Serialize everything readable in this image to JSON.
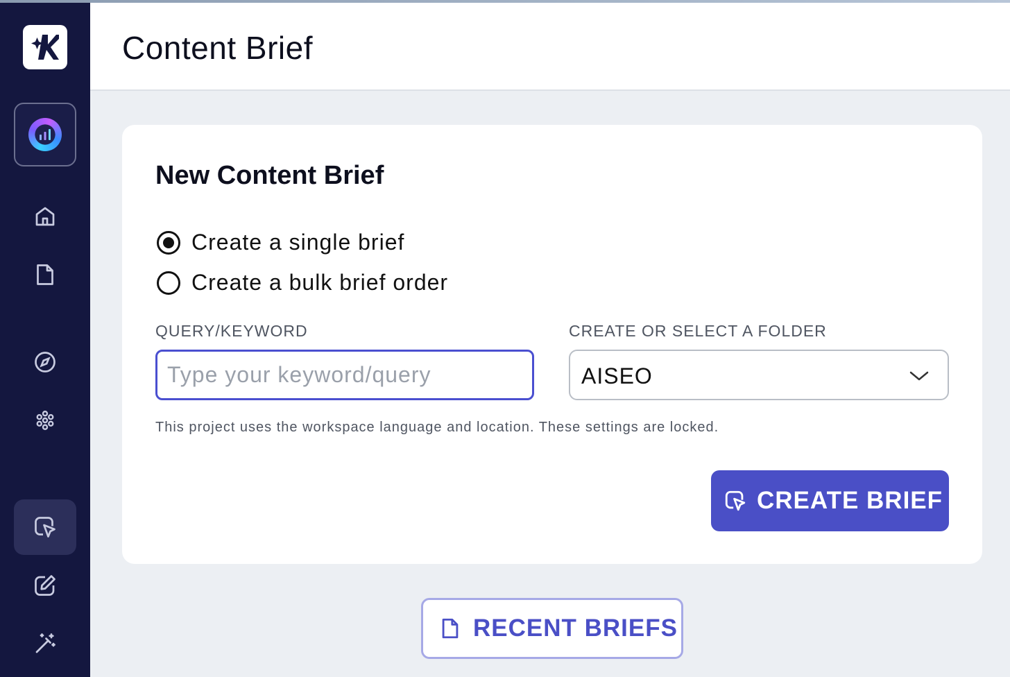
{
  "header": {
    "title": "Content Brief"
  },
  "sidebar": {
    "items": [
      {
        "name": "home",
        "icon": "home-icon"
      },
      {
        "name": "documents",
        "icon": "document-icon"
      },
      {
        "name": "explore",
        "icon": "compass-icon"
      },
      {
        "name": "clusters",
        "icon": "cluster-icon"
      },
      {
        "name": "content-brief",
        "icon": "cursor-click-icon",
        "active": true
      },
      {
        "name": "editor",
        "icon": "edit-icon"
      },
      {
        "name": "ai-tools",
        "icon": "magic-wand-icon"
      }
    ]
  },
  "card": {
    "title": "New Content Brief",
    "options": {
      "single": {
        "label": "Create a single brief",
        "selected": true
      },
      "bulk": {
        "label": "Create a bulk brief order",
        "selected": false
      }
    },
    "query": {
      "label": "QUERY/KEYWORD",
      "placeholder": "Type your keyword/query",
      "value": ""
    },
    "folder": {
      "label": "CREATE OR SELECT A FOLDER",
      "value": "AISEO"
    },
    "helper": "This project uses the workspace language and location. These settings are locked.",
    "create_button": "CREATE BRIEF"
  },
  "recent_button": "RECENT BRIEFS",
  "colors": {
    "sidebar": "#14173f",
    "accent": "#4a4fc6",
    "background": "#eceff3"
  }
}
